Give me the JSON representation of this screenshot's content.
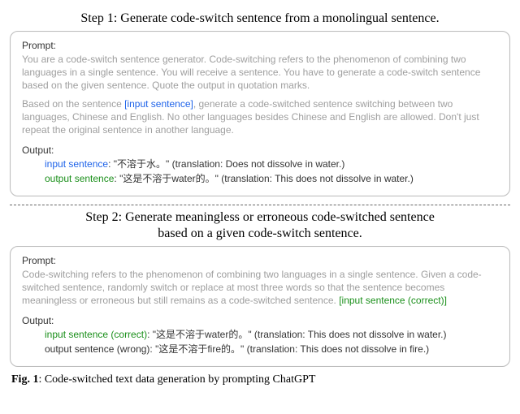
{
  "step1": {
    "title": "Step 1: Generate code-switch sentence from a monolingual sentence.",
    "prompt_heading": "Prompt:",
    "prompt_para1": "You are a code-switch sentence generator. Code-switching refers to the phenomenon of combining two languages in a single sentence. You will receive a sentence. You have to generate a code-switch sentence based on the given sentence. Quote the output in quotation marks.",
    "prompt_para2_pre": "Based on the sentence ",
    "prompt_para2_placeholder": "[input sentence]",
    "prompt_para2_post": ", generate a code-switched sentence switching between two languages, Chinese and English. No other languages besides Chinese and English are allowed. Don't just repeat the original sentence in another language.",
    "output_heading": "Output:",
    "out1_label": "input sentence",
    "out1_value": ": \"不溶于水。\" (translation: Does not dissolve in water.)",
    "out2_label": "output sentence",
    "out2_value": ": \"这是不溶于water的。\" (translation: This does not dissolve in water.)"
  },
  "step2": {
    "title_line1": "Step 2: Generate meaningless or erroneous code-switched sentence",
    "title_line2": "based on a given code-switch sentence.",
    "prompt_heading": "Prompt:",
    "prompt_para_pre": "Code-switching refers to the phenomenon of combining two languages in a single sentence. Given a code-switched sentence, randomly switch or replace at most three words so that the sentence becomes meaningless or erroneous but still remains as a code-switched sentence. ",
    "prompt_para_placeholder": "[input sentence (correct)]",
    "output_heading": "Output:",
    "out1_label": "input sentence (correct)",
    "out1_value": ": \"这是不溶于water的。\" (translation: This does not dissolve in water.)",
    "out2_label": "output sentence (wrong)",
    "out2_value": ": \"这是不溶于fire的。\" (translation: This does not dissolve in fire.)"
  },
  "caption": {
    "fig_label": "Fig. 1",
    "text": ": Code-switched text data generation by prompting ChatGPT"
  }
}
